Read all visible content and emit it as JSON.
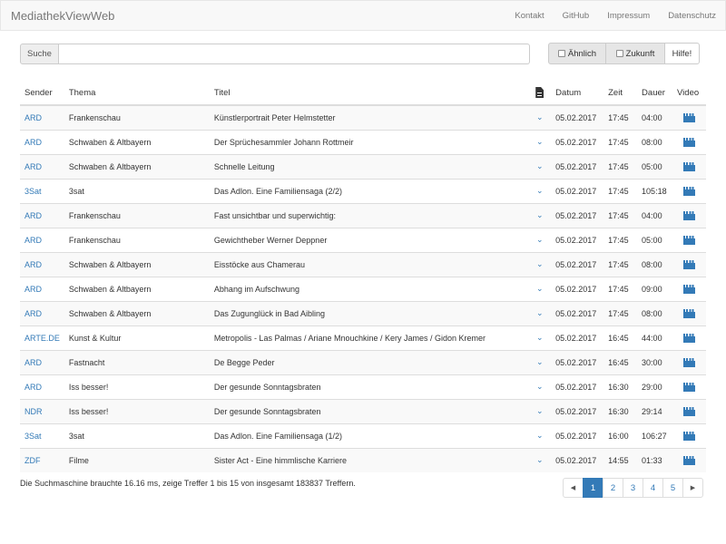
{
  "navbar": {
    "brand": "MediathekViewWeb",
    "links": [
      "Kontakt",
      "GitHub",
      "Impressum",
      "Datenschutz"
    ]
  },
  "search": {
    "label": "Suche",
    "value": "",
    "placeholder": ""
  },
  "options": {
    "similar_label": "Ähnlich",
    "future_label": "Zukunft",
    "help_label": "Hilfe!"
  },
  "table": {
    "headers": {
      "sender": "Sender",
      "thema": "Thema",
      "titel": "Titel",
      "description_icon": "file-text-icon",
      "datum": "Datum",
      "zeit": "Zeit",
      "dauer": "Dauer",
      "video": "Video"
    },
    "rows": [
      {
        "sender": "ARD",
        "thema": "Frankenschau",
        "titel": "Künstlerportrait Peter Helmstetter",
        "datum": "05.02.2017",
        "zeit": "17:45",
        "dauer": "04:00"
      },
      {
        "sender": "ARD",
        "thema": "Schwaben & Altbayern",
        "titel": "Der Sprüchesammler Johann Rottmeir",
        "datum": "05.02.2017",
        "zeit": "17:45",
        "dauer": "08:00"
      },
      {
        "sender": "ARD",
        "thema": "Schwaben & Altbayern",
        "titel": "Schnelle Leitung",
        "datum": "05.02.2017",
        "zeit": "17:45",
        "dauer": "05:00"
      },
      {
        "sender": "3Sat",
        "thema": "3sat",
        "titel": "Das Adlon. Eine Familiensaga (2/2)",
        "datum": "05.02.2017",
        "zeit": "17:45",
        "dauer": "105:18"
      },
      {
        "sender": "ARD",
        "thema": "Frankenschau",
        "titel": "Fast unsichtbar und superwichtig:",
        "datum": "05.02.2017",
        "zeit": "17:45",
        "dauer": "04:00"
      },
      {
        "sender": "ARD",
        "thema": "Frankenschau",
        "titel": "Gewichtheber Werner Deppner",
        "datum": "05.02.2017",
        "zeit": "17:45",
        "dauer": "05:00"
      },
      {
        "sender": "ARD",
        "thema": "Schwaben & Altbayern",
        "titel": "Eisstöcke aus Chamerau",
        "datum": "05.02.2017",
        "zeit": "17:45",
        "dauer": "08:00"
      },
      {
        "sender": "ARD",
        "thema": "Schwaben & Altbayern",
        "titel": "Abhang im Aufschwung",
        "datum": "05.02.2017",
        "zeit": "17:45",
        "dauer": "09:00"
      },
      {
        "sender": "ARD",
        "thema": "Schwaben & Altbayern",
        "titel": "Das Zugunglück in Bad Aibling",
        "datum": "05.02.2017",
        "zeit": "17:45",
        "dauer": "08:00"
      },
      {
        "sender": "ARTE.DE",
        "thema": "Kunst & Kultur",
        "titel": "Metropolis - Las Palmas / Ariane Mnouchkine / Kery James / Gidon Kremer",
        "datum": "05.02.2017",
        "zeit": "16:45",
        "dauer": "44:00"
      },
      {
        "sender": "ARD",
        "thema": "Fastnacht",
        "titel": "De Begge Peder",
        "datum": "05.02.2017",
        "zeit": "16:45",
        "dauer": "30:00"
      },
      {
        "sender": "ARD",
        "thema": "Iss besser!",
        "titel": "Der gesunde Sonntagsbraten",
        "datum": "05.02.2017",
        "zeit": "16:30",
        "dauer": "29:00"
      },
      {
        "sender": "NDR",
        "thema": "Iss besser!",
        "titel": "Der gesunde Sonntagsbraten",
        "datum": "05.02.2017",
        "zeit": "16:30",
        "dauer": "29:14"
      },
      {
        "sender": "3Sat",
        "thema": "3sat",
        "titel": "Das Adlon. Eine Familiensaga (1/2)",
        "datum": "05.02.2017",
        "zeit": "16:00",
        "dauer": "106:27"
      },
      {
        "sender": "ZDF",
        "thema": "Filme",
        "titel": "Sister Act - Eine himmlische Karriere",
        "datum": "05.02.2017",
        "zeit": "14:55",
        "dauer": "01:33"
      }
    ]
  },
  "status": {
    "text": "Die Suchmaschine brauchte 16.16 ms, zeige Treffer 1 bis 15 von insgesamt 183837 Treffern."
  },
  "pagination": {
    "prev_icon": "chevron-left-icon",
    "pages": [
      "1",
      "2",
      "3",
      "4",
      "5"
    ],
    "active_page": "1",
    "next_icon": "chevron-right-icon"
  },
  "colors": {
    "link": "#337ab7",
    "navbar_bg": "#f8f8f8",
    "stripe": "#f9f9f9",
    "border": "#dddddd"
  }
}
